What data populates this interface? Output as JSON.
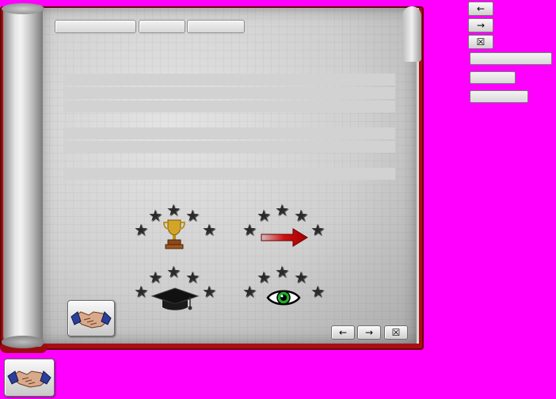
{
  "tabs": [
    "",
    "",
    ""
  ],
  "text_lines": [
    "",
    "",
    "",
    "",
    "",
    ""
  ],
  "side_fields": [
    "",
    "",
    ""
  ],
  "icons": {
    "back": "←",
    "forward": "→",
    "close": "☒",
    "star": "★"
  },
  "colors": {
    "background": "#ff00ff",
    "book_cover": "#a80f12",
    "arrow": "#d01010",
    "eye": "#1fae2a",
    "trophy": "#c8a020"
  }
}
